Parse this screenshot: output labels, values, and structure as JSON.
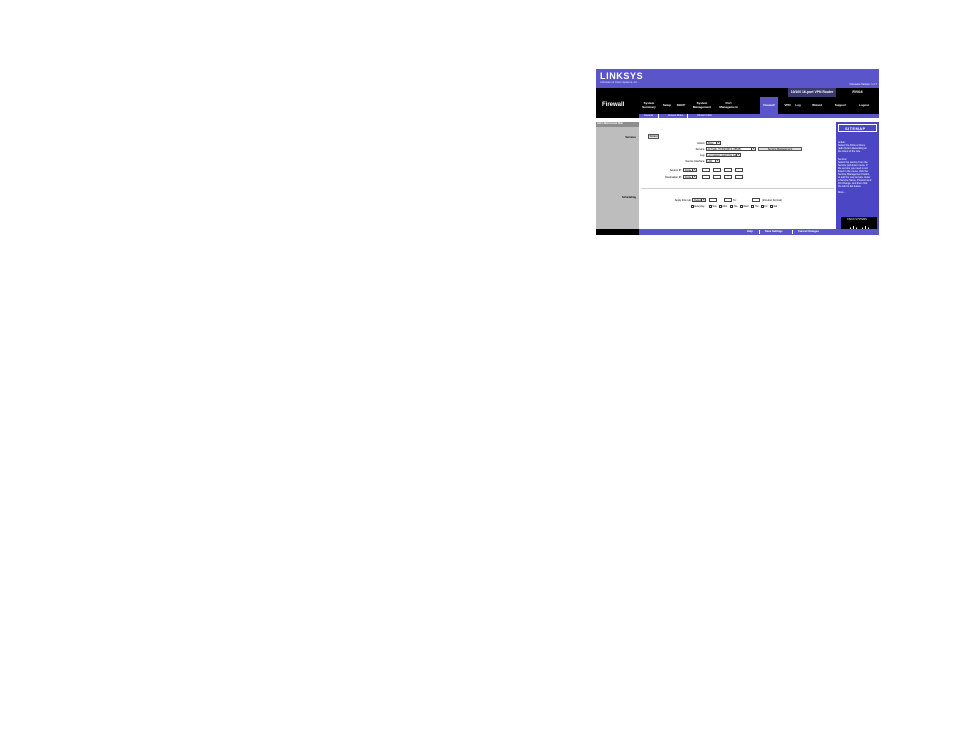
{
  "header": {
    "logo": "LINKSYS",
    "logo_sub": "A Division of Cisco Systems, Inc.",
    "firmware": "Firmware Version: 1.1.7",
    "model": "10/100 16-port VPN Router",
    "model_code": "RV016",
    "page_title": "Firewall"
  },
  "nav": {
    "tabs": [
      {
        "label": "System Summary"
      },
      {
        "label": "Setup"
      },
      {
        "label": "DHCP"
      },
      {
        "label": "System Management"
      },
      {
        "label": "Port Management"
      },
      {
        "label": "Firewall"
      },
      {
        "label": "VPN"
      },
      {
        "label": "Log"
      },
      {
        "label": "Wizard"
      },
      {
        "label": "Support"
      },
      {
        "label": "Logout"
      }
    ],
    "subnav": [
      "General",
      "Access Rules",
      "Content Filter"
    ]
  },
  "left": {
    "section_head": "Add a New Access Rule",
    "services_label": "Services",
    "scheduling_label": "Scheduling"
  },
  "form": {
    "wizard_button": "Wizard",
    "action_label": "Action:",
    "action_value": "Allow",
    "service_label": "Service:",
    "service_value": "All Traffic [TCP&UDP/1~65535]",
    "service_mgmt_button": "Service Management",
    "log_label": "Log:",
    "log_value": "Log packets match this rule",
    "source_iface_label": "Source Interface:",
    "source_iface_value": "LAN",
    "source_ip_label": "Source IP:",
    "source_ip_value": "Single",
    "dest_ip_label": "Destination IP:",
    "dest_ip_value": "Single",
    "apply_label": "Apply this rule",
    "apply_value": "Always",
    "to_label": "To:",
    "time_format": "(24-Hour Format)",
    "days": [
      "Everyday",
      "Sun",
      "Mon",
      "Tue",
      "Wed",
      "Thu",
      "Fri",
      "Sat"
    ]
  },
  "help": {
    "logo_text": "SITEMAP",
    "lines": [
      "Action:",
      "Select the Allow or Deny",
      "radio button depending on",
      "the intent of the rule.",
      "",
      "Service:",
      "Select the service from the",
      "Service pull-down menu. If",
      "the service you need is not",
      "listed in the menu, click the",
      "Service Management button",
      "to add the new service. Enter",
      "a Service Name, Protocol and",
      "Port Range, and then click",
      "the Add to list button.",
      "",
      "More..."
    ],
    "cisco_text": "CISCO SYSTEMS"
  },
  "footer": {
    "help": "Help",
    "save": "Save Settings",
    "cancel": "Cancel Changes"
  }
}
